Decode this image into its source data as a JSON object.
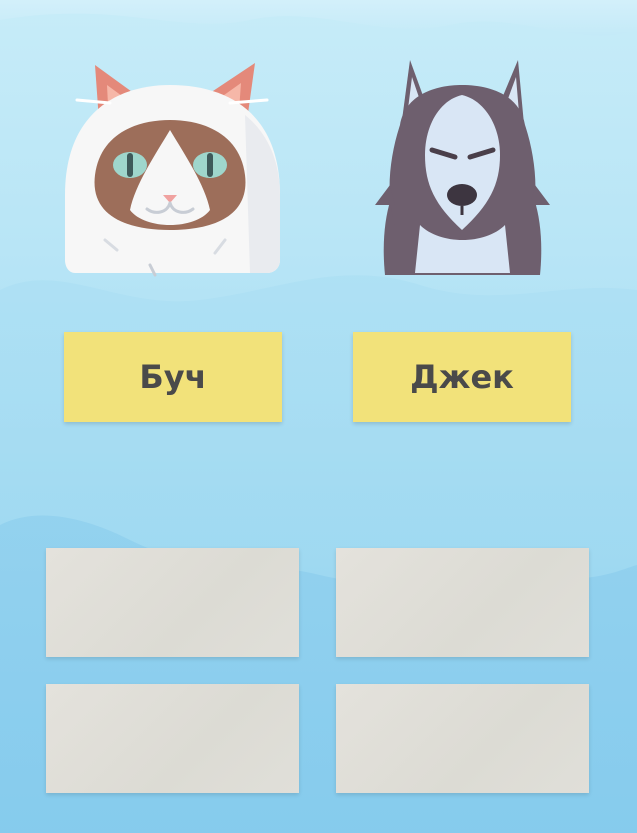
{
  "colors": {
    "background_top": "#c7ecf8",
    "background_bottom": "#86cced",
    "button_yellow": "#f2e27a",
    "button_text": "#4a4a4a",
    "slot_gray": "#e0dfd9"
  },
  "animals": [
    {
      "icon": "ragdoll-cat-icon"
    },
    {
      "icon": "husky-dog-icon"
    }
  ],
  "name_buttons": [
    {
      "label": "Буч"
    },
    {
      "label": "Джек"
    }
  ],
  "answer_slots": [
    {
      "value": ""
    },
    {
      "value": ""
    },
    {
      "value": ""
    },
    {
      "value": ""
    }
  ]
}
